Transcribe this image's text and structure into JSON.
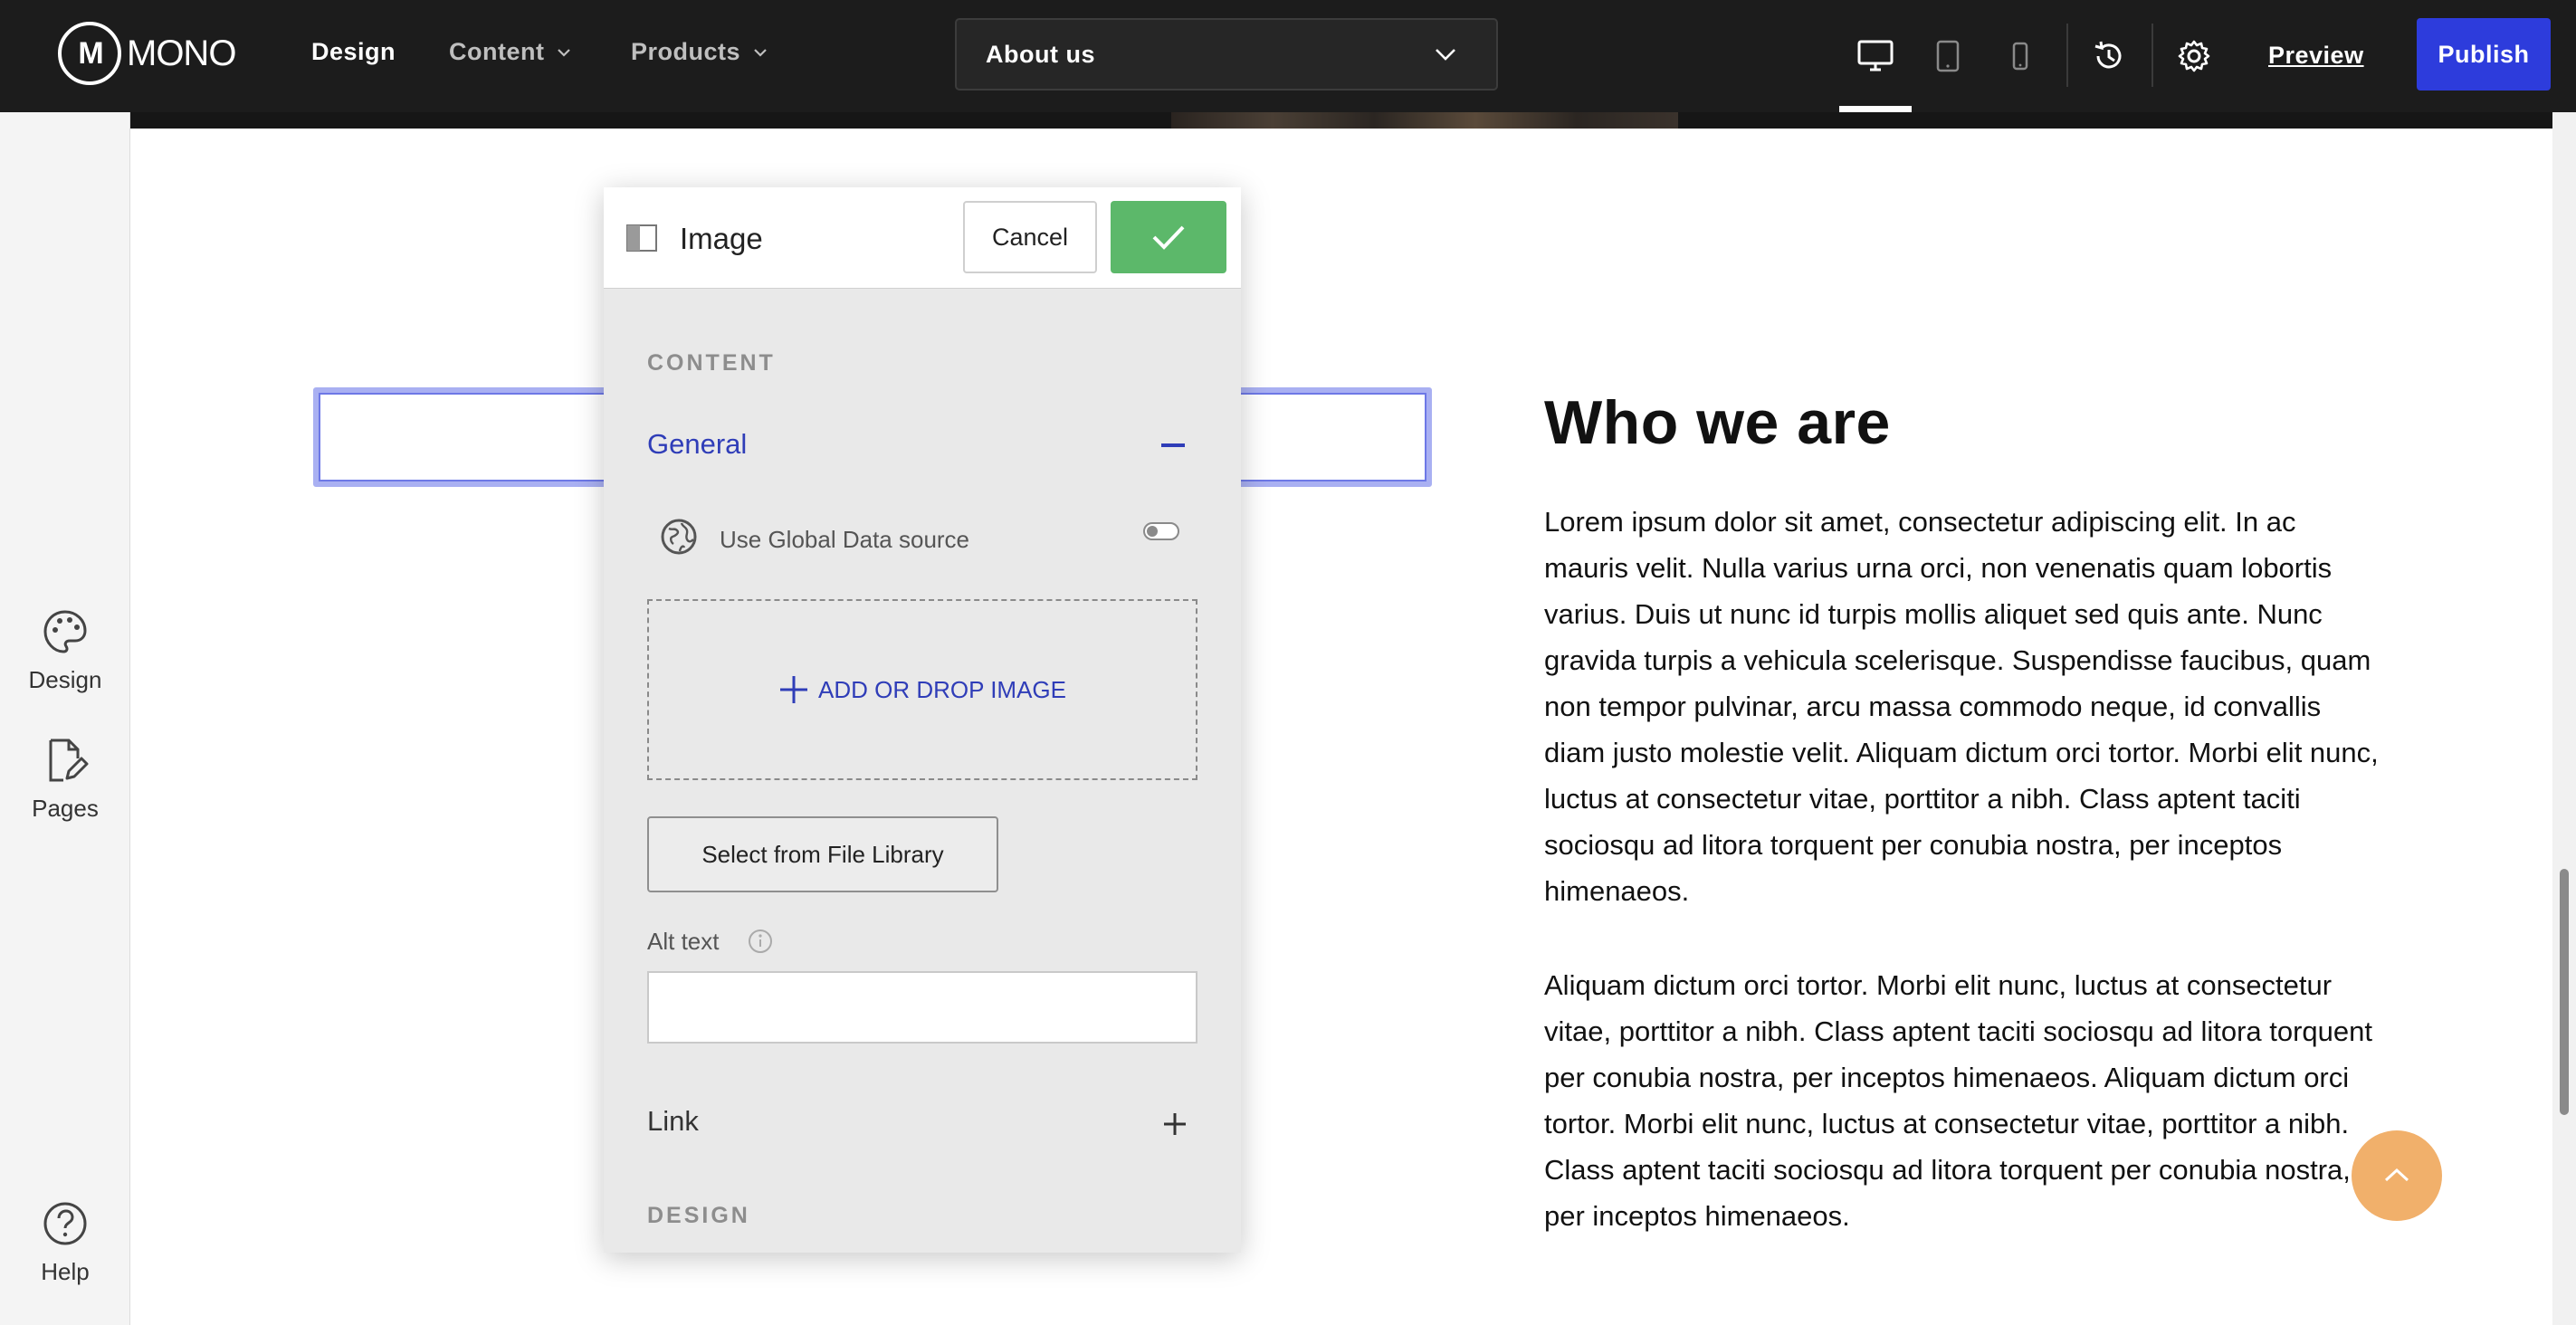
{
  "app": {
    "logo_text": "MONO",
    "logo_mark": "M"
  },
  "topbar": {
    "nav": [
      {
        "label": "Design",
        "active": true
      },
      {
        "label": "Content",
        "has_dropdown": true
      },
      {
        "label": "Products",
        "has_dropdown": true
      }
    ],
    "page_selector": {
      "value": "About us"
    },
    "devices": [
      "desktop-icon",
      "tablet-icon",
      "mobile-icon"
    ],
    "active_device": "desktop",
    "preview_label": "Preview",
    "publish_label": "Publish",
    "colors": {
      "bar": "#1c1c1c",
      "publish": "#2d3cdc"
    }
  },
  "sidebar": {
    "items": [
      {
        "label": "Design",
        "icon": "palette-icon"
      },
      {
        "label": "Pages",
        "icon": "page-edit-icon"
      },
      {
        "label": "Help",
        "icon": "help-icon"
      }
    ]
  },
  "page": {
    "heading": "Who we are",
    "paragraphs": [
      "Lorem ipsum dolor sit amet, consectetur adipiscing elit. In ac mauris velit. Nulla varius urna orci, non venenatis quam lobortis varius. Duis ut nunc id turpis mollis aliquet sed quis ante. Nunc gravida turpis a vehicula scelerisque. Suspendisse faucibus, quam non tempor pulvinar, arcu massa commodo neque, id convallis diam justo molestie velit. Aliquam dictum orci tortor. Morbi elit nunc, luctus at consectetur vitae, porttitor a nibh. Class aptent taciti sociosqu ad litora torquent per conubia nostra, per inceptos himenaeos.",
      "Aliquam dictum orci tortor. Morbi elit nunc, luctus at consectetur vitae, porttitor a nibh. Class aptent taciti sociosqu ad litora torquent per conubia nostra, per inceptos himenaeos. Aliquam dictum orci tortor. Morbi elit nunc, luctus at consectetur vitae, porttitor a nibh. Class aptent taciti sociosqu ad litora torquent per conubia nostra, per inceptos himenaeos."
    ],
    "scroll_top_color": "#f1b06b"
  },
  "panel": {
    "title": "Image",
    "cancel_label": "Cancel",
    "content_section": "CONTENT",
    "general_label": "General",
    "use_global_label": "Use Global Data source",
    "use_global_enabled": false,
    "drop_label": "ADD OR DROP IMAGE",
    "library_label": "Select from File Library",
    "alt_label": "Alt text",
    "alt_value": "",
    "link_label": "Link",
    "design_section": "DESIGN",
    "colors": {
      "accent": "#2f3db8",
      "confirm": "#5cb86a"
    }
  }
}
